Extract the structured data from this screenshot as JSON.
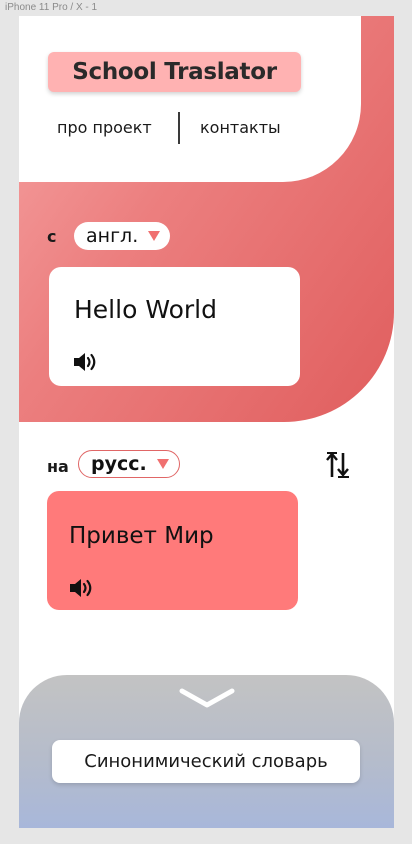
{
  "frame": {
    "label": "iPhone 11 Pro / X - 1"
  },
  "header": {
    "logo_text": "School Traslator",
    "nav": {
      "about": "про проект",
      "contacts": "контакты"
    }
  },
  "source": {
    "prefix": "с",
    "language": "англ.",
    "text": "Hello World",
    "speaker_icon": "speaker-icon"
  },
  "target": {
    "prefix": "на",
    "language": "русс.",
    "text": "Привет Мир",
    "speaker_icon": "speaker-icon"
  },
  "swap_icon": "swap-languages-icon",
  "bottom": {
    "expand_icon": "chevron-down-icon",
    "synonyms_button": "Синонимический словарь"
  },
  "colors": {
    "accent": "#ff7a7a",
    "logo_bg": "#ffb2b2",
    "dropdown_arrow": "#f07070"
  }
}
